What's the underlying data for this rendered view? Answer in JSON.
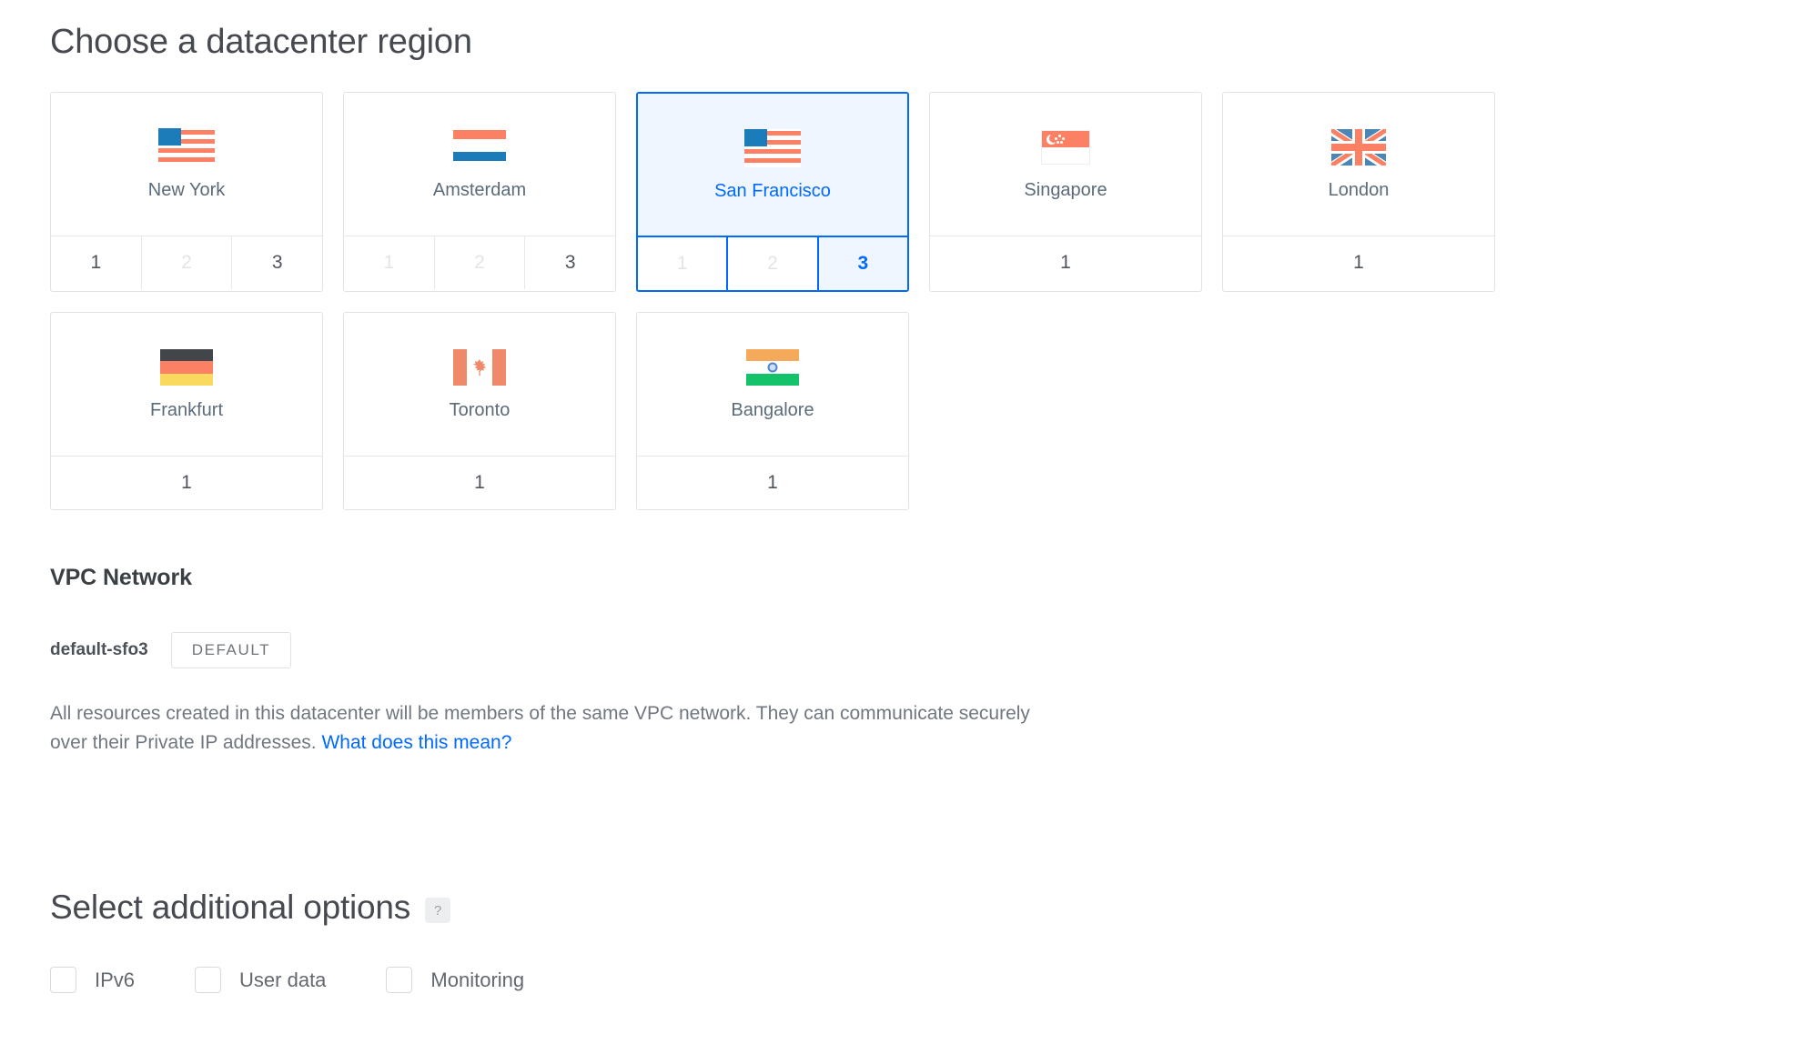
{
  "region_section": {
    "title": "Choose a datacenter region",
    "regions": [
      {
        "name": "New York",
        "flag": "us-flag-icon",
        "selected": false,
        "slugs": [
          {
            "label": "1",
            "state": "enabled"
          },
          {
            "label": "2",
            "state": "disabled"
          },
          {
            "label": "3",
            "state": "enabled"
          }
        ]
      },
      {
        "name": "Amsterdam",
        "flag": "nl-flag-icon",
        "selected": false,
        "slugs": [
          {
            "label": "1",
            "state": "disabled"
          },
          {
            "label": "2",
            "state": "disabled"
          },
          {
            "label": "3",
            "state": "enabled"
          }
        ]
      },
      {
        "name": "San Francisco",
        "flag": "us-flag-icon",
        "selected": true,
        "slugs": [
          {
            "label": "1",
            "state": "disabled"
          },
          {
            "label": "2",
            "state": "disabled"
          },
          {
            "label": "3",
            "state": "active"
          }
        ]
      },
      {
        "name": "Singapore",
        "flag": "sg-flag-icon",
        "selected": false,
        "slugs": [
          {
            "label": "1",
            "state": "enabled"
          }
        ]
      },
      {
        "name": "London",
        "flag": "gb-flag-icon",
        "selected": false,
        "slugs": [
          {
            "label": "1",
            "state": "enabled"
          }
        ]
      },
      {
        "name": "Frankfurt",
        "flag": "de-flag-icon",
        "selected": false,
        "slugs": [
          {
            "label": "1",
            "state": "enabled"
          }
        ]
      },
      {
        "name": "Toronto",
        "flag": "ca-flag-icon",
        "selected": false,
        "slugs": [
          {
            "label": "1",
            "state": "enabled"
          }
        ]
      },
      {
        "name": "Bangalore",
        "flag": "in-flag-icon",
        "selected": false,
        "slugs": [
          {
            "label": "1",
            "state": "enabled"
          }
        ]
      }
    ]
  },
  "vpc_section": {
    "title": "VPC Network",
    "network_name": "default-sfo3",
    "default_badge": "DEFAULT",
    "description": "All resources created in this datacenter will be members of the same VPC network. They can communicate securely over their Private IP addresses.",
    "learn_more_link": "What does this mean?"
  },
  "options_section": {
    "title": "Select additional options",
    "help_icon": "?",
    "checkboxes": [
      {
        "label": "IPv6",
        "checked": false
      },
      {
        "label": "User data",
        "checked": false
      },
      {
        "label": "Monitoring",
        "checked": false
      }
    ]
  },
  "colors": {
    "accent_blue": "#0069ff",
    "selected_bg": "#f0f6ff",
    "flag_salmon": "#fc8063",
    "flag_blue": "#1c7cb9",
    "border_grey": "#dfe3e8",
    "text_dark": "#46494f",
    "text_muted": "#707780",
    "disabled_grey": "#e2e5e8"
  }
}
